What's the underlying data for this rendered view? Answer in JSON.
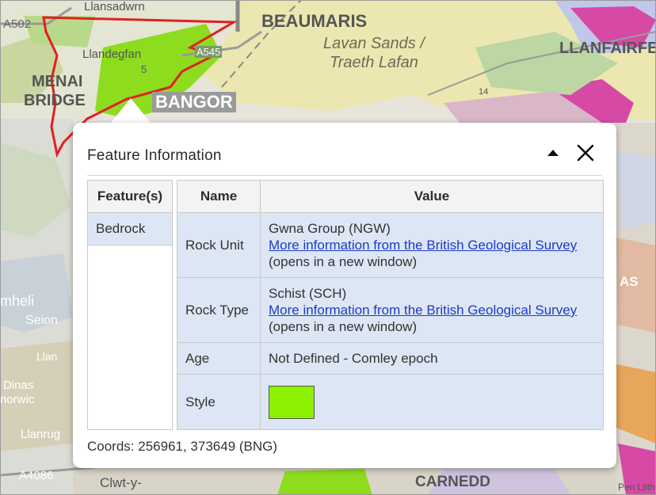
{
  "map": {
    "labels": {
      "llansadwrn": "Llansadwrn",
      "beaumaris": "BEAUMARIS",
      "lavan_sands": "Lavan Sands /",
      "traeth_lafan": "Traeth Lafan",
      "llanfairfec": "LLANFAIRFEC",
      "llandegfan": "Llandegfan",
      "menai": "MENAI",
      "bridge": "BRIDGE",
      "bangor": "BANGOR",
      "a502": "A502",
      "a545": "A545",
      "road_14": "14",
      "road_5": "5",
      "as_label": "AS",
      "mheli": "mheli",
      "seion": "Seion",
      "llan": "Llan",
      "dinas": "Dinas",
      "norwic": "norwic",
      "llanrug": "Llanrug",
      "a4086": "A4086",
      "clwt": "Clwt-y-",
      "carnedd": "CARNEDD",
      "pen_llith": "Pen Llith"
    },
    "colors": {
      "green": "#8ddc1e",
      "estuary": "#ece7b0",
      "magenta": "#d64aa6",
      "outline": "#e02020"
    }
  },
  "popup": {
    "title": "Feature Information",
    "collapse_icon": "triangle-up-icon",
    "close_icon": "close-x-icon",
    "features": {
      "header": "Feature(s)",
      "items": [
        "Bedrock"
      ]
    },
    "table": {
      "headers": {
        "name": "Name",
        "value": "Value"
      },
      "rows": [
        {
          "name": "Rock Unit",
          "value": "Gwna Group (NGW)",
          "link": "More information from the British Geological Survey",
          "note": "(opens in a new window)"
        },
        {
          "name": "Rock Type",
          "value": "Schist (SCH)",
          "link": "More information from the British Geological Survey",
          "note": "(opens in a new window)"
        },
        {
          "name": "Age",
          "value": "Not Defined - Comley epoch"
        },
        {
          "name": "Style",
          "swatch_color": "#8cf000"
        }
      ]
    },
    "coords": "Coords: 256961, 373649 (BNG)"
  }
}
